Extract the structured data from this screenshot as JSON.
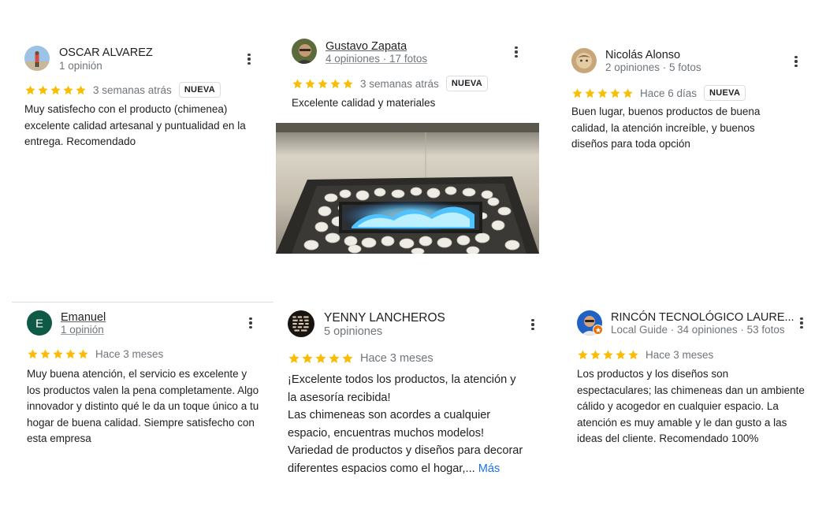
{
  "colors": {
    "star": "#fbbc04",
    "link": "#1a73e8",
    "text": "#202124",
    "muted": "#70757a"
  },
  "reviews": [
    {
      "name": "OSCAR ALVAREZ",
      "meta": "1 opinión",
      "rating": 5,
      "date": "3 semanas atrás",
      "badge": "NUEVA",
      "text": "Muy satisfecho con el producto (chimenea) excelente calidad artesanal y puntualidad en la entrega. Recomendado"
    },
    {
      "name": "Gustavo Zapata",
      "meta": "4 opiniones · 17 fotos",
      "rating": 5,
      "date": "3 semanas atrás",
      "badge": "NUEVA",
      "text": "Excelente calidad y materiales",
      "photo": "fireplace-photo"
    },
    {
      "name": "Nicolás Alonso",
      "meta": "2 opiniones · 5 fotos",
      "rating": 5,
      "date": "Hace 6 días",
      "badge": "NUEVA",
      "text": "Buen lugar, buenos productos de buena calidad, la atención increíble, y buenos diseños para toda opción"
    },
    {
      "name": "Emanuel",
      "meta": "1 opinión",
      "avatar_letter": "E",
      "avatar_color": "#0f5a46",
      "rating": 5,
      "date": "Hace 3 meses",
      "text": "Muy buena atención, el servicio es excelente y los productos valen la pena completamente. Algo innovador y distinto qué le da un toque único a tu hogar de buena calidad. Siempre satisfecho con esta empresa"
    },
    {
      "name": "YENNY LANCHEROS",
      "meta": "5 opiniones",
      "rating": 5,
      "date": "Hace 3 meses",
      "text_lines": [
        "¡Excelente todos los productos, la atención y",
        "la asesoría recibida!",
        "Las chimeneas son acordes a cualquier",
        "espacio, encuentras muchos modelos!",
        "Variedad de productos y diseños para decorar",
        "diferentes espacios como el hogar,..."
      ],
      "more_label": "Más"
    },
    {
      "name": "RINCÓN TECNOLÓGICO LAURE...",
      "meta": "Local Guide · 34 opiniones · 53 fotos",
      "rating": 5,
      "date": "Hace 3 meses",
      "text": "Los productos y los diseños son espectaculares; las chimeneas dan un ambiente cálido y acogedor en cualquier espacio. La atención es muy amable y le dan gusto a las ideas del cliente. Recomendado 100%"
    }
  ]
}
